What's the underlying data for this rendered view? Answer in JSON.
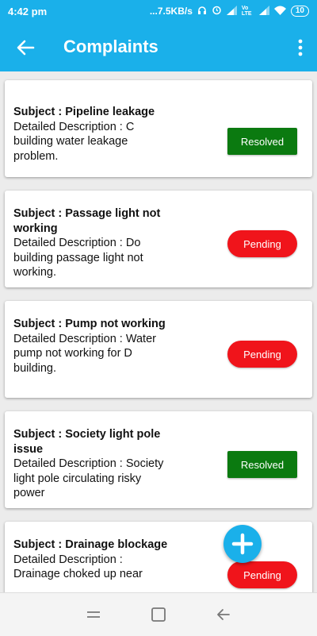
{
  "status_bar": {
    "time": "4:42 pm",
    "net_speed": "...7.5KB/s",
    "volte_label": "Vo LTE",
    "battery": "10"
  },
  "app_bar": {
    "title": "Complaints",
    "back_icon": "arrow-back-icon",
    "menu_icon": "more-vert-icon",
    "color": "#1ab0ea"
  },
  "complaints": [
    {
      "subject_line": "Subject :  Pipeline leakage",
      "description_line": "Detailed Description  :    C building water leakage problem.",
      "status": "Resolved"
    },
    {
      "subject_line": "Subject :  Passage light not working",
      "description_line": "Detailed Description  :  Do building passage light not working.",
      "status": "Pending"
    },
    {
      "subject_line": "Subject :  Pump not working",
      "description_line": "Detailed Description  :  Water pump not working for D building.",
      "status": "Pending"
    },
    {
      "subject_line": "Subject :  Society light pole issue",
      "description_line": "Detailed Description  :  Society light pole circulating risky power",
      "status": "Resolved"
    },
    {
      "subject_line": "Subject :  Drainage blockage",
      "description_line": "Detailed Description  :  Drainage choked up near",
      "status": "Pending"
    }
  ],
  "colors": {
    "resolved": "#0b7a10",
    "pending": "#f0141b"
  },
  "fab_icon": "add-icon",
  "nav_bar": {
    "recents_icon": "recents-icon",
    "home_icon": "home-icon",
    "back_icon": "nav-back-icon"
  }
}
